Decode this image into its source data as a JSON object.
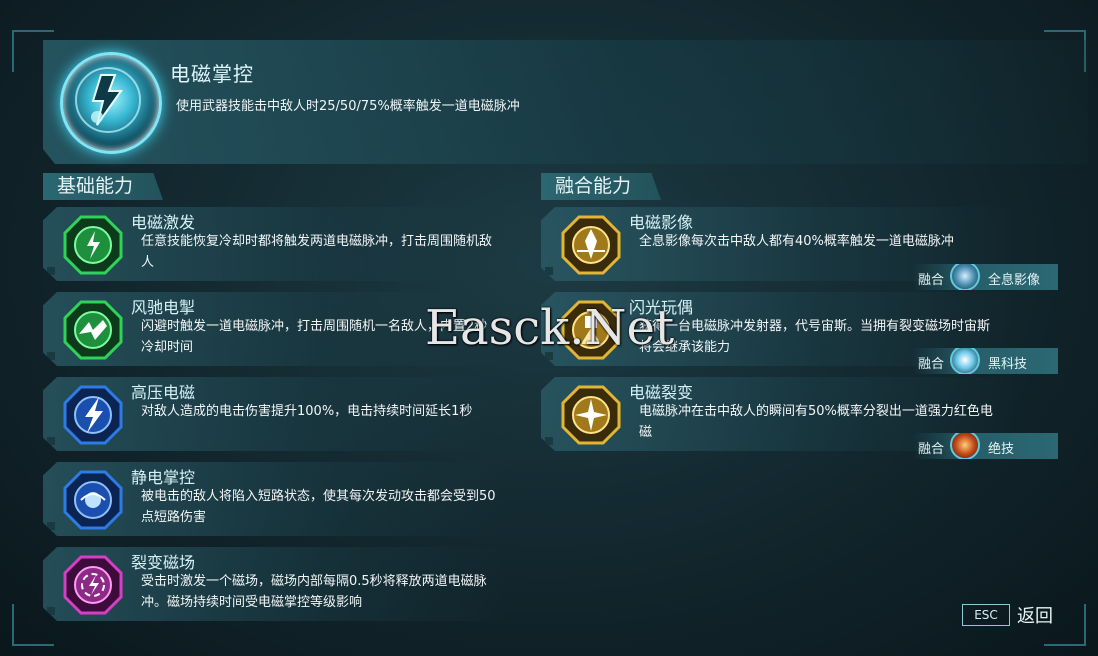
{
  "header": {
    "title": "电磁掌控",
    "description": "使用武器技能击中敌人时25/50/75%概率触发一道电磁脉冲"
  },
  "sections": {
    "basic_title": "基础能力",
    "fusion_title": "融合能力"
  },
  "basic": [
    {
      "title": "电磁激发",
      "desc": "任意技能恢复冷却时都将触发两道电磁脉冲，打击周围随机敌人",
      "color": "#2fd35a",
      "icon": "lightning-burst-icon"
    },
    {
      "title": "风驰电掣",
      "desc": "闪避时触发一道电磁脉冲，打击周围随机一名敌人，内置2秒冷却时间",
      "color": "#2fd35a",
      "icon": "dash-lightning-icon"
    },
    {
      "title": "高压电磁",
      "desc": "对敌人造成的电击伤害提升100%，电击持续时间延长1秒",
      "color": "#2d7be6",
      "icon": "high-voltage-icon"
    },
    {
      "title": "静电掌控",
      "desc": "被电击的敌人将陷入短路状态，使其每次发动攻击都会受到50点短路伤害",
      "color": "#2d7be6",
      "icon": "static-orb-icon"
    },
    {
      "title": "裂变磁场",
      "desc": "受击时激发一个磁场，磁场内部每隔0.5秒将释放两道电磁脉冲。磁场持续时间受电磁掌控等级影响",
      "color": "#d43fc4",
      "icon": "magnetic-field-icon"
    }
  ],
  "fusion": [
    {
      "title": "电磁影像",
      "desc": "全息影像每次击中敌人都有40%概率触发一道电磁脉冲",
      "color": "#e2b532",
      "icon": "hologram-icon",
      "fusion_label": "融合",
      "fusion_name": "全息影像",
      "fusion_icon": "hologram-badge-icon"
    },
    {
      "title": "闪光玩偶",
      "desc": "获得一台电磁脉冲发射器，代号宙斯。当拥有裂变磁场时宙斯将会继承该能力",
      "color": "#e2b532",
      "icon": "flash-doll-icon",
      "fusion_label": "融合",
      "fusion_name": "黑科技",
      "fusion_icon": "tech-badge-icon"
    },
    {
      "title": "电磁裂变",
      "desc": "电磁脉冲在击中敌人的瞬间有50%概率分裂出一道强力红色电磁",
      "color": "#e2b532",
      "icon": "fission-icon",
      "fusion_label": "融合",
      "fusion_name": "绝技",
      "fusion_icon": "ultimate-badge-icon"
    }
  ],
  "watermark": "Easck.Net",
  "footer": {
    "esc": "ESC",
    "back": "返回"
  }
}
